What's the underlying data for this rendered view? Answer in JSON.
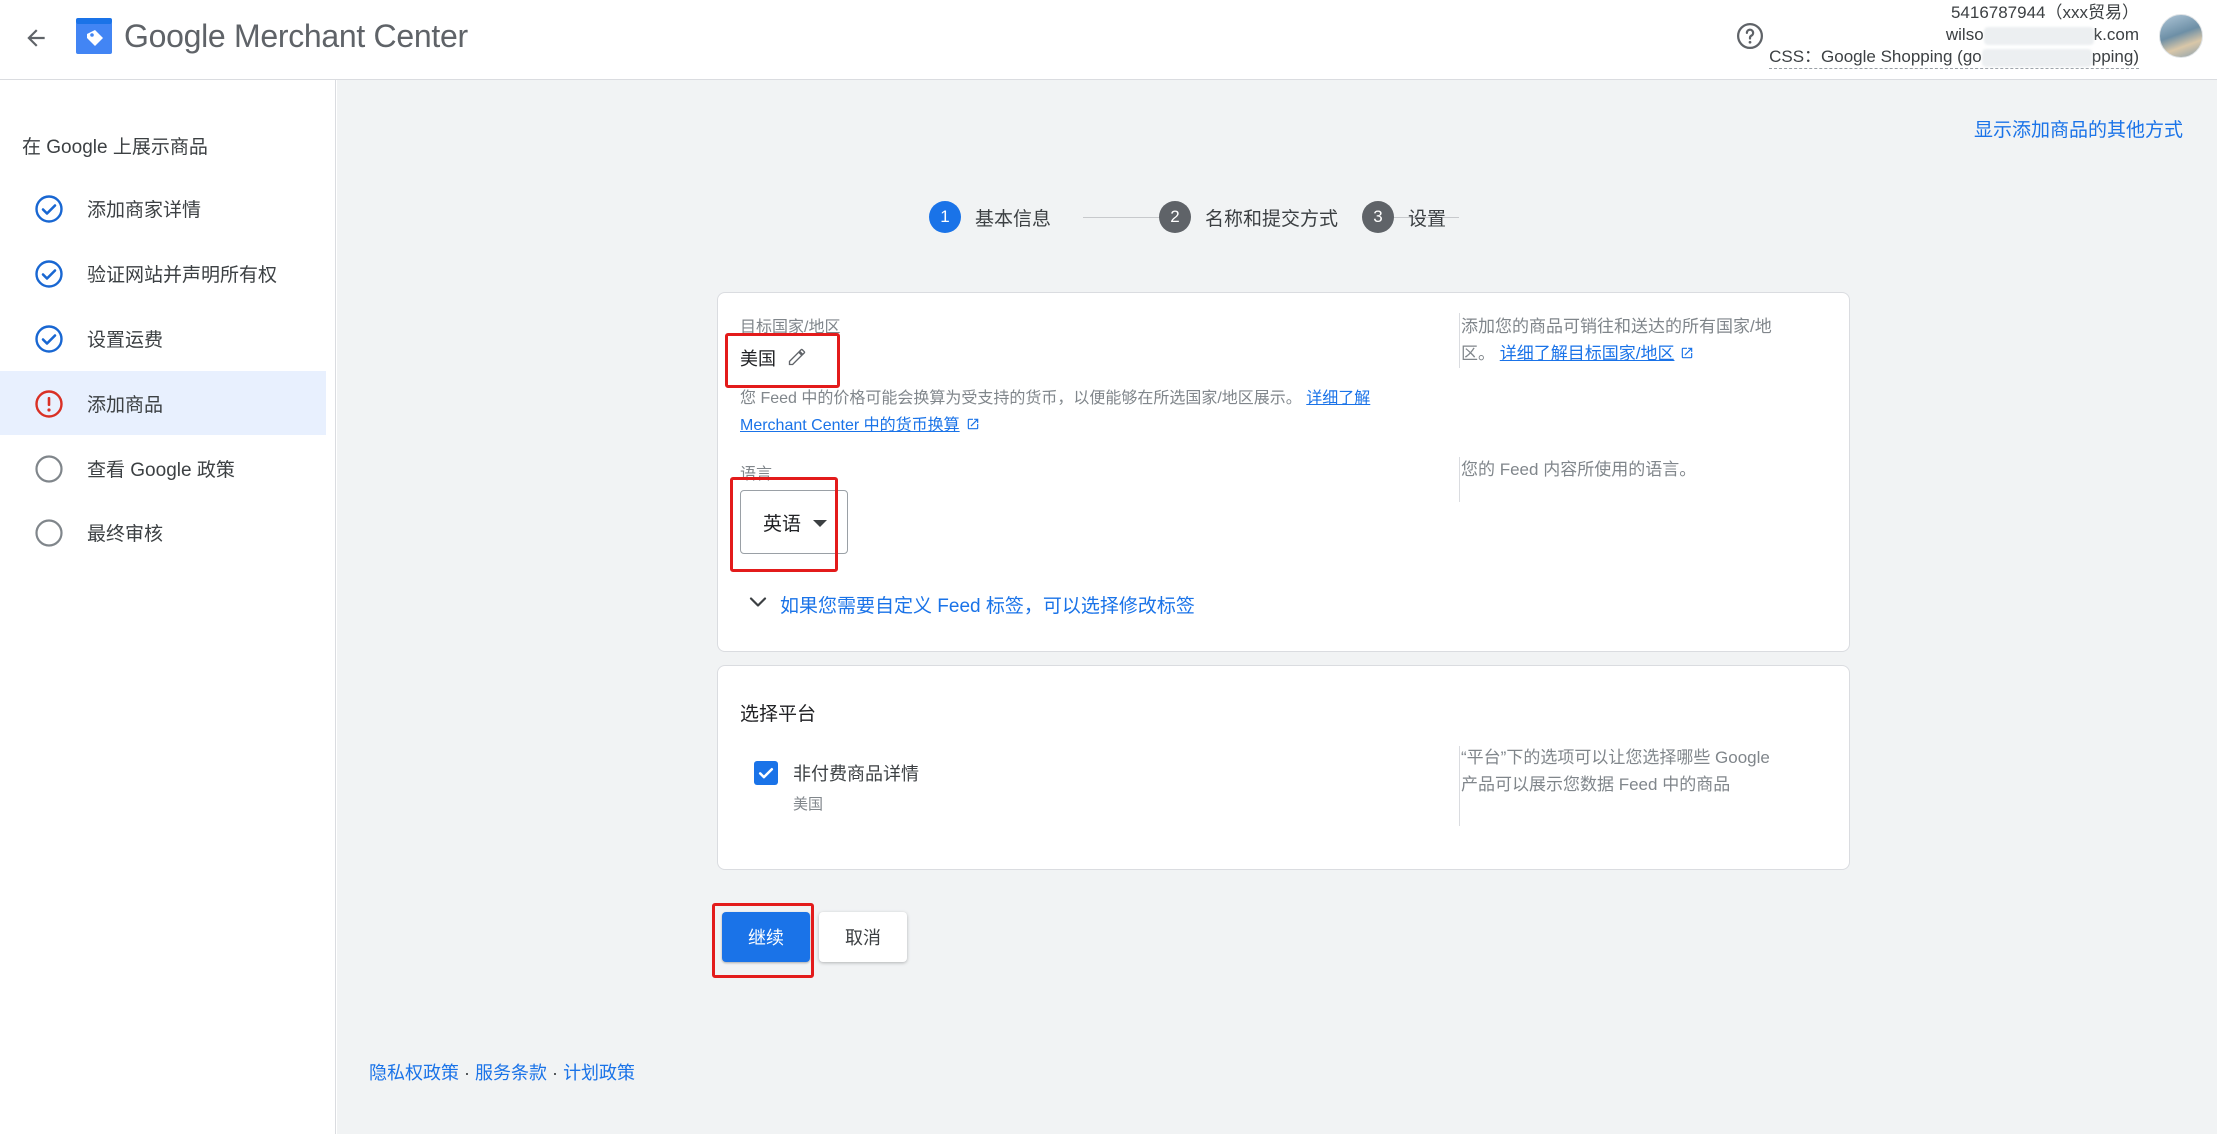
{
  "app": {
    "title": "Google Merchant Center",
    "brand_color": "#4285f4"
  },
  "account": {
    "name": "5416787944（xxx贸易）",
    "email_start": "wilso",
    "email_end": "k.com",
    "css_start": "CSS：Google Shopping (go",
    "css_end": "pping)"
  },
  "sidebar": {
    "heading": "在 Google 上展示商品",
    "items": [
      {
        "label": "添加商家详情",
        "status": "done",
        "icon": "check-circle-icon"
      },
      {
        "label": "验证网站并声明所有权",
        "status": "done",
        "icon": "check-circle-icon"
      },
      {
        "label": "设置运费",
        "status": "done",
        "icon": "check-circle-icon"
      },
      {
        "label": "添加商品",
        "status": "error",
        "icon": "error-circle-icon"
      },
      {
        "label": "查看 Google 政策",
        "status": "todo",
        "icon": "empty-circle-icon"
      },
      {
        "label": "最终审核",
        "status": "todo",
        "icon": "empty-circle-icon"
      }
    ]
  },
  "main": {
    "alt_link": "显示添加商品的其他方式",
    "stepper": [
      {
        "num": "1",
        "label": "基本信息",
        "active": true
      },
      {
        "num": "2",
        "label": "名称和提交方式",
        "active": false
      },
      {
        "num": "3",
        "label": "设置",
        "active": false
      }
    ],
    "country": {
      "label": "目标国家/地区",
      "value": "美国",
      "note_text": "您 Feed 中的价格可能会换算为受支持的货币，以便能够在所选国家/地区展示。",
      "note_link": "详细了解 Merchant Center 中的货币换算",
      "help_text": "添加您的商品可销往和送达的所有国家/地区。",
      "help_link": "详细了解目标国家/地区"
    },
    "language": {
      "label": "语言",
      "value": "英语",
      "help_text": "您的 Feed 内容所使用的语言。"
    },
    "expand_label": "如果您需要自定义 Feed 标签，可以选择修改标签",
    "platform": {
      "title": "选择平台",
      "checkbox_label": "非付费商品详情",
      "checkbox_sub": "美国",
      "checked": true,
      "help_text": "“平台”下的选项可以让您选择哪些 Google 产品可以展示您数据 Feed 中的商品"
    },
    "buttons": {
      "continue": "继续",
      "cancel": "取消"
    }
  },
  "footer": {
    "privacy": "隐私权政策",
    "terms": "服务条款",
    "program": "计划政策",
    "separator": "·"
  },
  "colors": {
    "accent": "#1a73e8",
    "done": "#1967d2",
    "error": "#d93025",
    "step_inactive": "#5f6368",
    "highlight_box": "#e31b1b"
  }
}
